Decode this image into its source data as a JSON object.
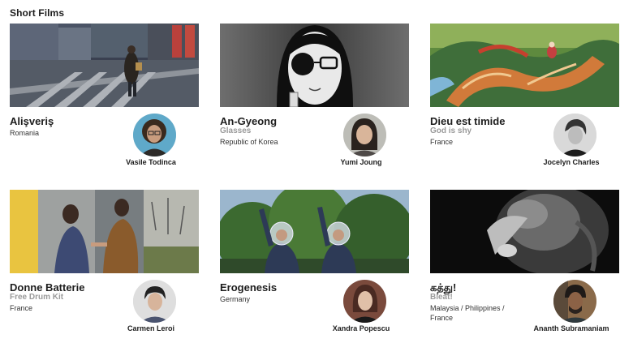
{
  "section": {
    "title": "Short Films"
  },
  "films": [
    {
      "title": "Alişveriş",
      "subtitle": "",
      "country": "Romania",
      "director": "Vasile Todinca"
    },
    {
      "title": "An-Gyeong",
      "subtitle": "Glasses",
      "country": "Republic of Korea",
      "director": "Yumi Joung"
    },
    {
      "title": "Dieu est timide",
      "subtitle": "God is shy",
      "country": "France",
      "director": "Jocelyn Charles"
    },
    {
      "title": "Donne Batterie",
      "subtitle": "Free Drum Kit",
      "country": "France",
      "director": "Carmen Leroi"
    },
    {
      "title": "Erogenesis",
      "subtitle": "",
      "country": "Germany",
      "director": "Xandra Popescu"
    },
    {
      "title": "கத்து!",
      "subtitle": "Bleat!",
      "country": "Malaysia / Philippines / France",
      "director": "Ananth Subramaniam"
    }
  ],
  "colors": {
    "title": "#1d1d1d",
    "subtitle": "#9a9a9a",
    "background": "#ffffff"
  }
}
